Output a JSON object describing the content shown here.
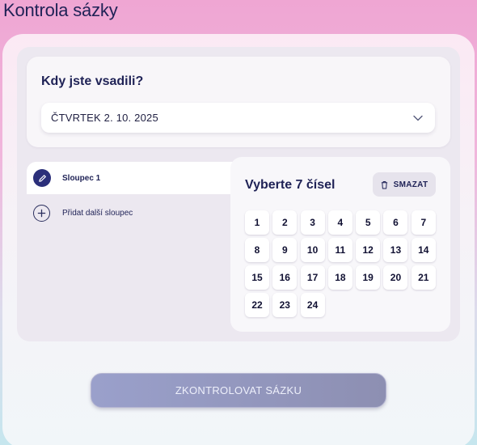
{
  "header": {
    "title": "Kontrola sázky"
  },
  "date_section": {
    "heading": "Kdy jste vsadili?",
    "selected_date": "ČTVRTEK 2. 10. 2025",
    "chevron_icon": "chevron-down-icon"
  },
  "columns": {
    "active_label": "Sloupec 1",
    "active_icon": "pencil-icon",
    "add_label": "Přidat další sloupec",
    "add_icon": "plus-icon"
  },
  "picker": {
    "heading": "Vyberte 7 čísel",
    "clear_label": "SMAZAT",
    "clear_icon": "trash-icon",
    "numbers": [
      "1",
      "2",
      "3",
      "4",
      "5",
      "6",
      "7",
      "8",
      "9",
      "10",
      "11",
      "12",
      "13",
      "14",
      "15",
      "16",
      "17",
      "18",
      "19",
      "20",
      "21",
      "22",
      "23",
      "24"
    ]
  },
  "submit": {
    "label": "ZKONTROLOVAT SÁZKU"
  },
  "colors": {
    "primary_text": "#1f2256",
    "accent_dark": "#2b2f7a",
    "button_bg": "#9aa0cb"
  }
}
